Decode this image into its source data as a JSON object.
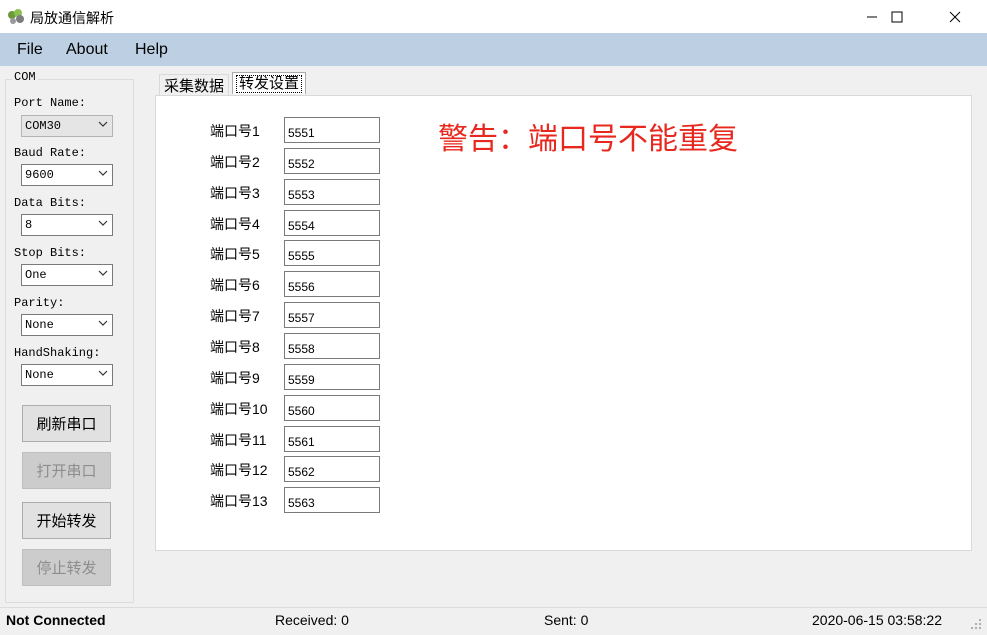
{
  "window": {
    "title": "局放通信解析"
  },
  "menu": {
    "file": "File",
    "about": "About",
    "help": "Help"
  },
  "com": {
    "legend": "COM",
    "port_name_label": "Port Name:",
    "port_name_value": "COM30",
    "baud_rate_label": "Baud Rate:",
    "baud_rate_value": "9600",
    "data_bits_label": "Data Bits:",
    "data_bits_value": "8",
    "stop_bits_label": "Stop Bits:",
    "stop_bits_value": "One",
    "parity_label": "Parity:",
    "parity_value": "None",
    "handshaking_label": "HandShaking:",
    "handshaking_value": "None"
  },
  "buttons": {
    "refresh": "刷新串口",
    "open": "打开串口",
    "start_forward": "开始转发",
    "stop_forward": "停止转发"
  },
  "tabs": {
    "collect": "采集数据",
    "forward": "转发设置"
  },
  "ports": [
    {
      "label": "端口号1",
      "value": "5551"
    },
    {
      "label": "端口号2",
      "value": "5552"
    },
    {
      "label": "端口号3",
      "value": "5553"
    },
    {
      "label": "端口号4",
      "value": "5554"
    },
    {
      "label": "端口号5",
      "value": "5555"
    },
    {
      "label": "端口号6",
      "value": "5556"
    },
    {
      "label": "端口号7",
      "value": "5557"
    },
    {
      "label": "端口号8",
      "value": "5558"
    },
    {
      "label": "端口号9",
      "value": "5559"
    },
    {
      "label": "端口号10",
      "value": "5560"
    },
    {
      "label": "端口号11",
      "value": "5561"
    },
    {
      "label": "端口号12",
      "value": "5562"
    },
    {
      "label": "端口号13",
      "value": "5563"
    }
  ],
  "warning": "警告：端口号不能重复",
  "status": {
    "connection": "Not Connected",
    "received": "Received: 0",
    "sent": "Sent: 0",
    "datetime": "2020-06-15 03:58:22"
  },
  "colors": {
    "menubar": "#bdd0e3",
    "warning": "#e8281e"
  }
}
